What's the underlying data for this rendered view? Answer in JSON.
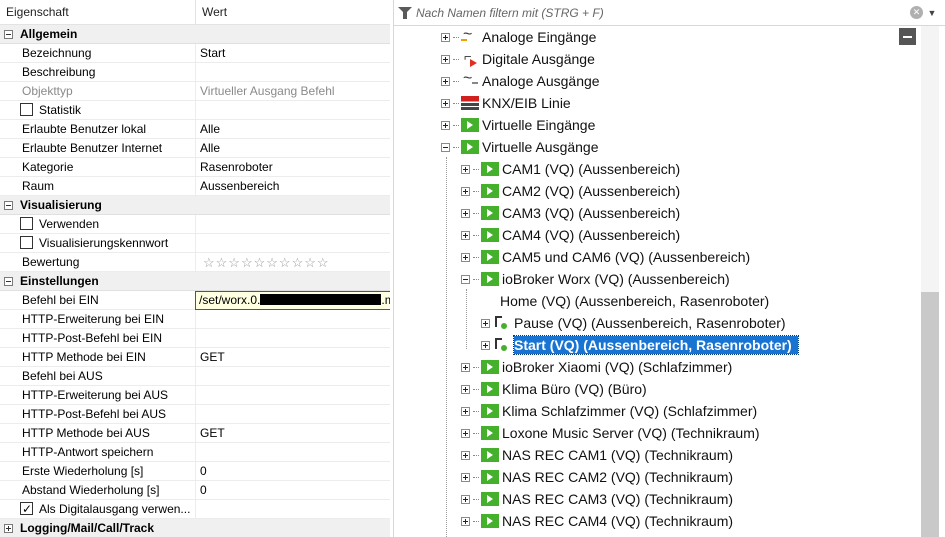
{
  "grid": {
    "col_property": "Eigenschaft",
    "col_value": "Wert",
    "cat_allgemein": "Allgemein",
    "cat_visualisierung": "Visualisierung",
    "cat_einstellungen": "Einstellungen",
    "cat_logging": "Logging/Mail/Call/Track",
    "rows": {
      "bezeichnung": {
        "name": "Bezeichnung",
        "value": "Start"
      },
      "beschreibung": {
        "name": "Beschreibung",
        "value": ""
      },
      "objekttyp": {
        "name": "Objekttyp",
        "value": "Virtueller Ausgang Befehl"
      },
      "statistik": {
        "name": "Statistik",
        "checked": false
      },
      "benutzer_lokal": {
        "name": "Erlaubte Benutzer lokal",
        "value": "Alle"
      },
      "benutzer_internet": {
        "name": "Erlaubte Benutzer Internet",
        "value": "Alle"
      },
      "kategorie": {
        "name": "Kategorie",
        "value": "Rasenroboter"
      },
      "raum": {
        "name": "Raum",
        "value": "Aussenbereich"
      },
      "verwenden": {
        "name": "Verwenden",
        "checked": false
      },
      "viskennwort": {
        "name": "Visualisierungskennwort",
        "checked": false
      },
      "bewertung": {
        "name": "Bewertung",
        "stars": "☆☆☆☆☆☆☆☆☆☆"
      },
      "befehl_ein": {
        "name": "Befehl bei EIN",
        "value": ""
      },
      "http_erw_ein": {
        "name": "HTTP-Erweiterung bei EIN",
        "value": ""
      },
      "http_post_ein": {
        "name": "HTTP-Post-Befehl bei EIN",
        "value": ""
      },
      "http_methode_ein": {
        "name": "HTTP Methode bei EIN",
        "value": "GET"
      },
      "befehl_aus": {
        "name": "Befehl bei AUS",
        "value": ""
      },
      "http_erw_aus": {
        "name": "HTTP-Erweiterung bei AUS",
        "value": ""
      },
      "http_post_aus": {
        "name": "HTTP-Post-Befehl bei AUS",
        "value": ""
      },
      "http_methode_aus": {
        "name": "HTTP Methode bei AUS",
        "value": "GET"
      },
      "http_antwort": {
        "name": "HTTP-Antwort speichern",
        "value": ""
      },
      "erste_wdh": {
        "name": "Erste Wiederholung [s]",
        "value": "0"
      },
      "abstand_wdh": {
        "name": "Abstand Wiederholung [s]",
        "value": "0"
      },
      "digitalausgang": {
        "name": "Als Digitalausgang verwen...",
        "checked": true
      }
    },
    "tooltip_prefix": "/set/worx.0.",
    "tooltip_suffix": ".mower.state?value=true"
  },
  "tree": {
    "filter_placeholder": "Nach Namen filtern mit (STRG + F)",
    "nodes": {
      "analoge_eingaenge": "Analoge Eingänge",
      "digitale_ausgaenge": "Digitale Ausgänge",
      "analoge_ausgaenge": "Analoge Ausgänge",
      "knx": "KNX/EIB Linie",
      "virt_eingaenge": "Virtuelle Eingänge",
      "virt_ausgaenge": "Virtuelle Ausgänge",
      "cam1": "CAM1 (VQ) (Aussenbereich)",
      "cam2": "CAM2 (VQ) (Aussenbereich)",
      "cam3": "CAM3 (VQ) (Aussenbereich)",
      "cam4": "CAM4 (VQ) (Aussenbereich)",
      "cam56": "CAM5 und CAM6 (VQ) (Aussenbereich)",
      "worx": "ioBroker Worx (VQ) (Aussenbereich)",
      "home": "Home (VQ) (Aussenbereich, Rasenroboter)",
      "pause": "Pause (VQ) (Aussenbereich, Rasenroboter)",
      "start": "Start (VQ) (Aussenbereich, Rasenroboter)",
      "xiaomi": "ioBroker Xiaomi (VQ) (Schlafzimmer)",
      "klima_buero": "Klima Büro (VQ) (Büro)",
      "klima_schlaf": "Klima Schlafzimmer (VQ) (Schlafzimmer)",
      "loxone": "Loxone Music Server (VQ) (Technikraum)",
      "nas1": "NAS REC CAM1 (VQ) (Technikraum)",
      "nas2": "NAS REC CAM2 (VQ) (Technikraum)",
      "nas3": "NAS REC CAM3 (VQ) (Technikraum)",
      "nas4": "NAS REC CAM4 (VQ) (Technikraum)"
    }
  },
  "colors": {
    "selection": "#1874d3",
    "virtual_green": "#44b02b"
  }
}
